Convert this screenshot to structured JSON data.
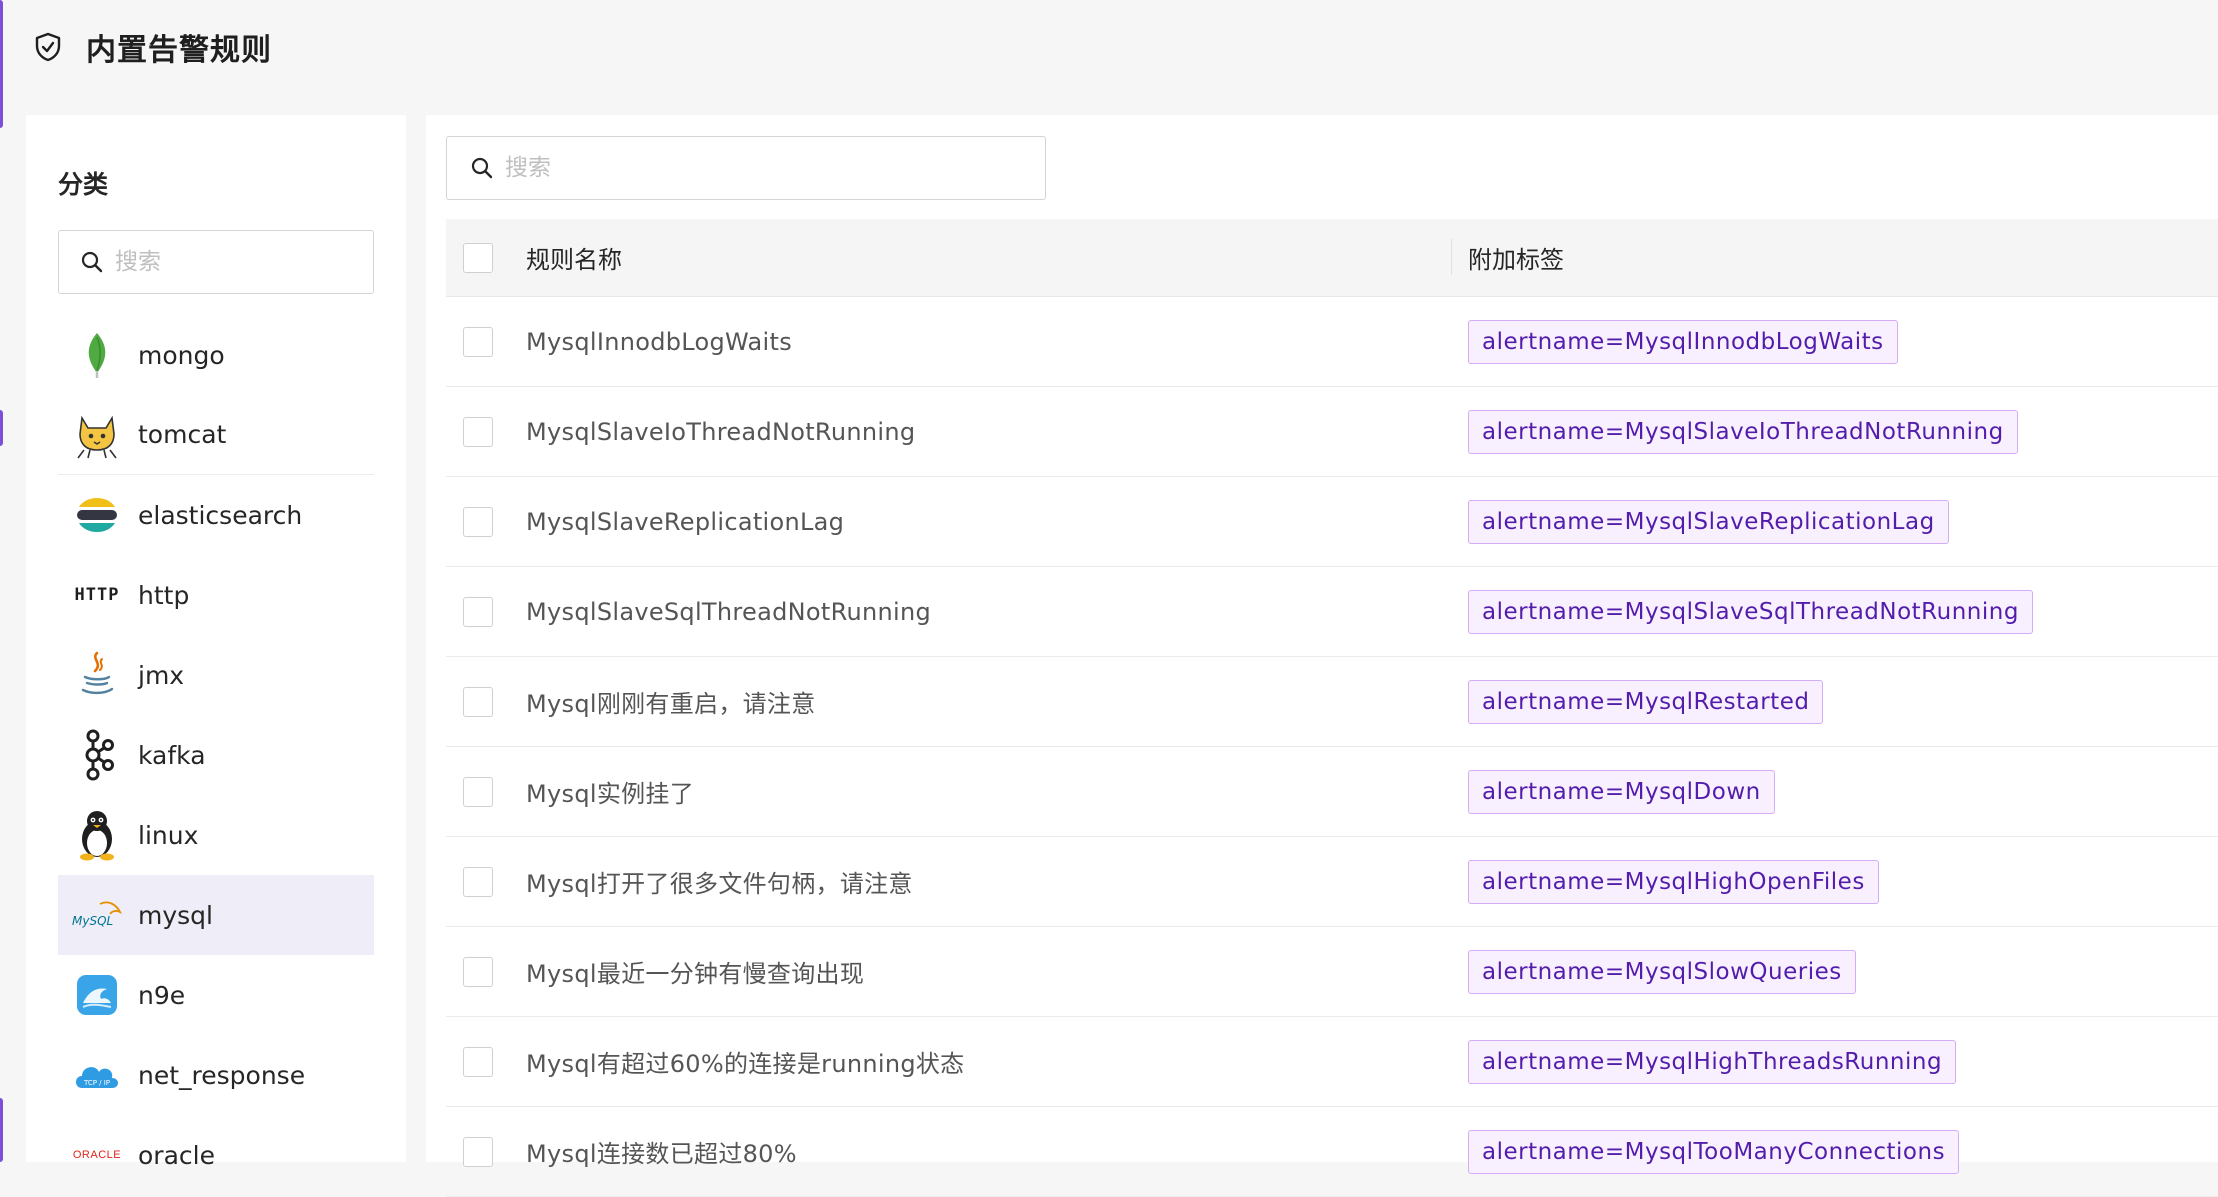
{
  "page": {
    "title": "内置告警规则"
  },
  "sidebar": {
    "title": "分类",
    "search_placeholder": "搜索",
    "items": [
      {
        "label": "mongo",
        "icon": "mongo-leaf-icon"
      },
      {
        "label": "tomcat",
        "icon": "tomcat-icon"
      },
      {
        "label": "elasticsearch",
        "icon": "elasticsearch-icon"
      },
      {
        "label": "http",
        "icon": "http-icon",
        "icon_text": "HTTP"
      },
      {
        "label": "jmx",
        "icon": "java-icon"
      },
      {
        "label": "kafka",
        "icon": "kafka-icon"
      },
      {
        "label": "linux",
        "icon": "linux-tux-icon"
      },
      {
        "label": "mysql",
        "icon": "mysql-icon",
        "icon_text": "MySQL",
        "active": true
      },
      {
        "label": "n9e",
        "icon": "n9e-icon"
      },
      {
        "label": "net_response",
        "icon": "tcp-ip-cloud-icon",
        "icon_text": "TCP / IP"
      },
      {
        "label": "oracle",
        "icon": "oracle-icon",
        "icon_text": "ORACLE"
      }
    ]
  },
  "main": {
    "search_placeholder": "搜索",
    "table": {
      "headers": {
        "name": "规则名称",
        "tags": "附加标签"
      },
      "rows": [
        {
          "name": "MysqlInnodbLogWaits",
          "tag": "alertname=MysqlInnodbLogWaits"
        },
        {
          "name": "MysqlSlaveIoThreadNotRunning",
          "tag": "alertname=MysqlSlaveIoThreadNotRunning"
        },
        {
          "name": "MysqlSlaveReplicationLag",
          "tag": "alertname=MysqlSlaveReplicationLag"
        },
        {
          "name": "MysqlSlaveSqlThreadNotRunning",
          "tag": "alertname=MysqlSlaveSqlThreadNotRunning"
        },
        {
          "name": "Mysql刚刚有重启，请注意",
          "tag": "alertname=MysqlRestarted"
        },
        {
          "name": "Mysql实例挂了",
          "tag": "alertname=MysqlDown"
        },
        {
          "name": "Mysql打开了很多文件句柄，请注意",
          "tag": "alertname=MysqlHighOpenFiles"
        },
        {
          "name": "Mysql最近一分钟有慢查询出现",
          "tag": "alertname=MysqlSlowQueries"
        },
        {
          "name": "Mysql有超过60%的连接是running状态",
          "tag": "alertname=MysqlHighThreadsRunning"
        },
        {
          "name": "Mysql连接数已超过80%",
          "tag": "alertname=MysqlTooManyConnections"
        }
      ]
    }
  },
  "colors": {
    "accent": "#7b4fd6",
    "active_bg": "#efedf8",
    "tag_bg": "#f9f0ff",
    "tag_border": "#d3adf7",
    "tag_text": "#531dab"
  }
}
